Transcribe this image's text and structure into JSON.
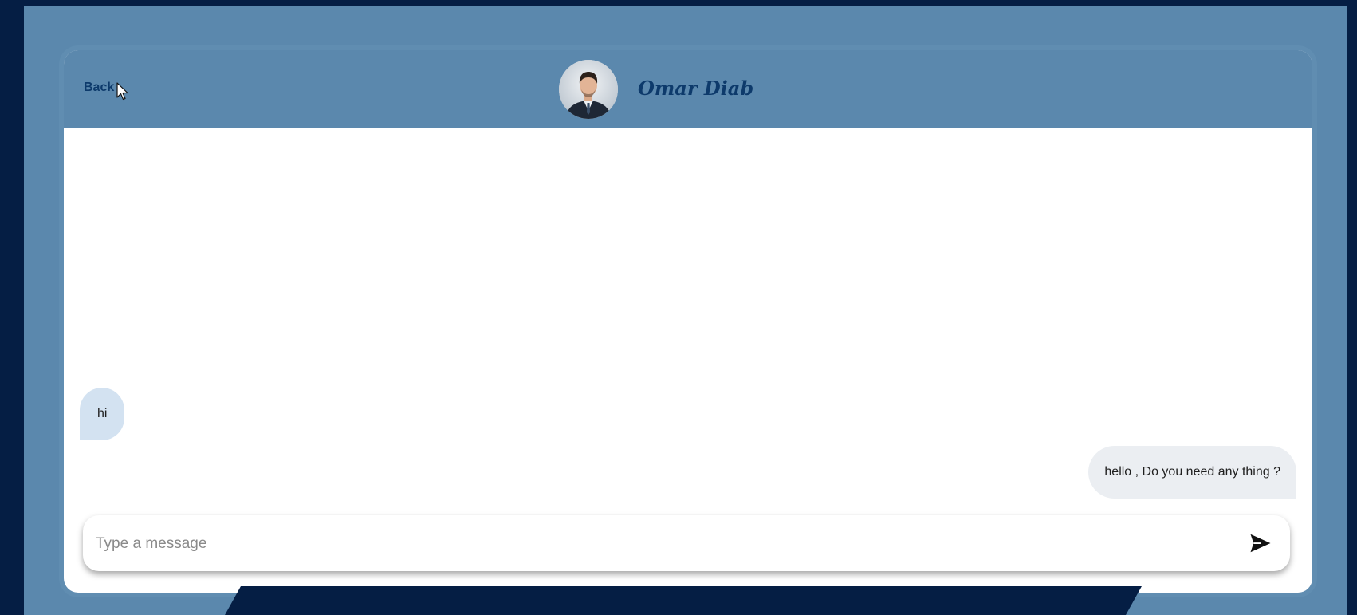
{
  "header": {
    "back_label": "Back",
    "contact_name": "Omar Diab"
  },
  "messages": [
    {
      "direction": "incoming",
      "text": "hi"
    },
    {
      "direction": "outgoing",
      "text": "hello , Do you need any thing ?"
    }
  ],
  "composer": {
    "placeholder": "Type a message",
    "value": ""
  },
  "icons": {
    "send": "send-icon",
    "cursor": "mouse-cursor-icon"
  },
  "colors": {
    "background": "#051e44",
    "frame": "#5b88ad",
    "accent_text": "#0d3a6b",
    "incoming_bubble": "#d3e2f1",
    "outgoing_bubble": "#ebeef2"
  }
}
